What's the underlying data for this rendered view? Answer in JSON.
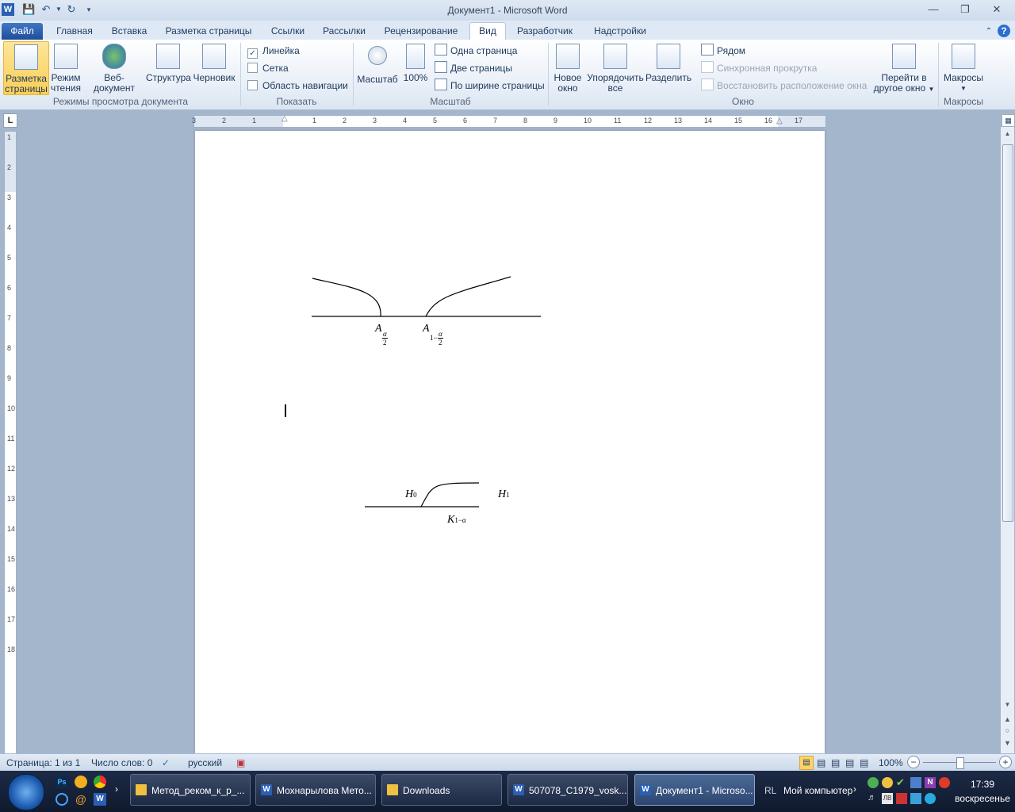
{
  "window": {
    "title": "Документ1  -  Microsoft Word",
    "app_icon": "W"
  },
  "tabs": [
    "Файл",
    "Главная",
    "Вставка",
    "Разметка страницы",
    "Ссылки",
    "Рассылки",
    "Рецензирование",
    "Вид",
    "Разработчик",
    "Надстройки"
  ],
  "active_tab": "Вид",
  "ribbon": {
    "views": {
      "label": "Режимы просмотра документа",
      "buttons": [
        {
          "line1": "Разметка",
          "line2": "страницы",
          "selected": true
        },
        {
          "line1": "Режим",
          "line2": "чтения"
        },
        {
          "line1": "Веб-документ",
          "line2": ""
        },
        {
          "line1": "Структура",
          "line2": ""
        },
        {
          "line1": "Черновик",
          "line2": ""
        }
      ]
    },
    "show": {
      "label": "Показать",
      "items": [
        {
          "text": "Линейка",
          "checked": true
        },
        {
          "text": "Сетка",
          "checked": false
        },
        {
          "text": "Область навигации",
          "checked": false
        }
      ]
    },
    "zoom": {
      "label": "Масштаб",
      "zoom_button": "Масштаб",
      "hundred_button": "100%",
      "items": [
        "Одна страница",
        "Две страницы",
        "По ширине страницы"
      ]
    },
    "window": {
      "label": "Окно",
      "new_window": {
        "line1": "Новое",
        "line2": "окно"
      },
      "arrange": {
        "line1": "Упорядочить",
        "line2": "все"
      },
      "split": "Разделить",
      "side_items": [
        "Рядом",
        "Синхронная прокрутка",
        "Восстановить расположение окна"
      ],
      "switch": {
        "line1": "Перейти в",
        "line2": "другое окно"
      }
    },
    "macros": {
      "label": "Макросы",
      "button": "Макросы"
    }
  },
  "ruler": {
    "h_ticks": [
      "3",
      "2",
      "1",
      "1",
      "2",
      "3",
      "4",
      "5",
      "6",
      "7",
      "8",
      "9",
      "10",
      "11",
      "12",
      "13",
      "14",
      "15",
      "16",
      "17"
    ],
    "v_ticks": [
      "1",
      "2",
      "3",
      "4",
      "5",
      "6",
      "7",
      "8",
      "9",
      "10",
      "11",
      "12",
      "13",
      "14",
      "15",
      "16",
      "17",
      "18"
    ]
  },
  "document": {
    "eq1": {
      "a_left": "A",
      "frac_num": "α",
      "frac_den": "2",
      "a_right": "A",
      "sub_prefix": "1−"
    },
    "eq2": {
      "h0": "H",
      "h0_sub": "0",
      "h1": "H",
      "h1_sub": "1",
      "k": "K",
      "k_sub": "1−α"
    }
  },
  "status": {
    "page": "Страница: 1 из 1",
    "words": "Число слов: 0",
    "language": "русский",
    "zoom": "100%"
  },
  "taskbar": {
    "tasks": [
      {
        "label": "Метод_реком_к_р_...",
        "icon": "folder-icon"
      },
      {
        "label": "Мохнарылова Мето...",
        "icon": "word-icon"
      },
      {
        "label": "Downloads",
        "icon": "folder-icon"
      },
      {
        "label": "507078_C1979_vosk...",
        "icon": "word-icon"
      },
      {
        "label": "Документ1 - Microso...",
        "icon": "word-icon",
        "active": true
      }
    ],
    "computer": "Мой компьютер",
    "lang": "RL",
    "time": "17:39",
    "day": "воскресенье"
  }
}
